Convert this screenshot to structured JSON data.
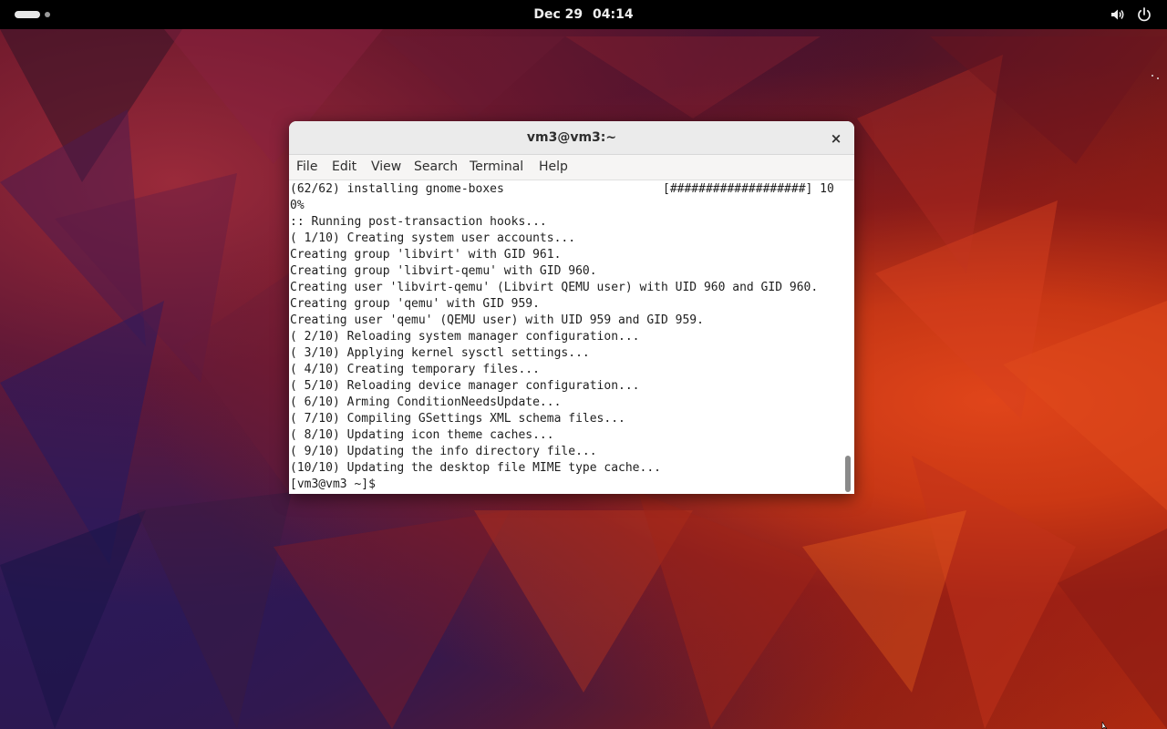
{
  "top_bar": {
    "date": "Dec 29",
    "time": "04:14",
    "icons": [
      "activities-icon",
      "volume-icon",
      "power-icon"
    ]
  },
  "window": {
    "title": "vm3@vm3:~",
    "close_label": "×",
    "menu": [
      "File",
      "Edit",
      "View",
      "Search",
      "Terminal",
      "Help"
    ]
  },
  "terminal": {
    "lines": [
      "(62/62) installing gnome-boxes",
      "0%",
      ":: Running post-transaction hooks...",
      "( 1/10) Creating system user accounts...",
      "Creating group 'libvirt' with GID 961.",
      "Creating group 'libvirt-qemu' with GID 960.",
      "Creating user 'libvirt-qemu' (Libvirt QEMU user) with UID 960 and GID 960.",
      "Creating group 'qemu' with GID 959.",
      "Creating user 'qemu' (QEMU user) with UID 959 and GID 959.",
      "( 2/10) Reloading system manager configuration...",
      "( 3/10) Applying kernel sysctl settings...",
      "( 4/10) Creating temporary files...",
      "( 5/10) Reloading device manager configuration...",
      "( 6/10) Arming ConditionNeedsUpdate...",
      "( 7/10) Compiling GSettings XML schema files...",
      "( 8/10) Updating icon theme caches...",
      "( 9/10) Updating the info directory file...",
      "(10/10) Updating the desktop file MIME type cache...",
      "[vm3@vm3 ~]$"
    ],
    "progress_text": "[###################] 10"
  },
  "colors": {
    "top_bar": "#000000",
    "terminal_bg": "#ffffff",
    "terminal_text": "#1e1e1e",
    "titlebar": "#ebebeb"
  }
}
